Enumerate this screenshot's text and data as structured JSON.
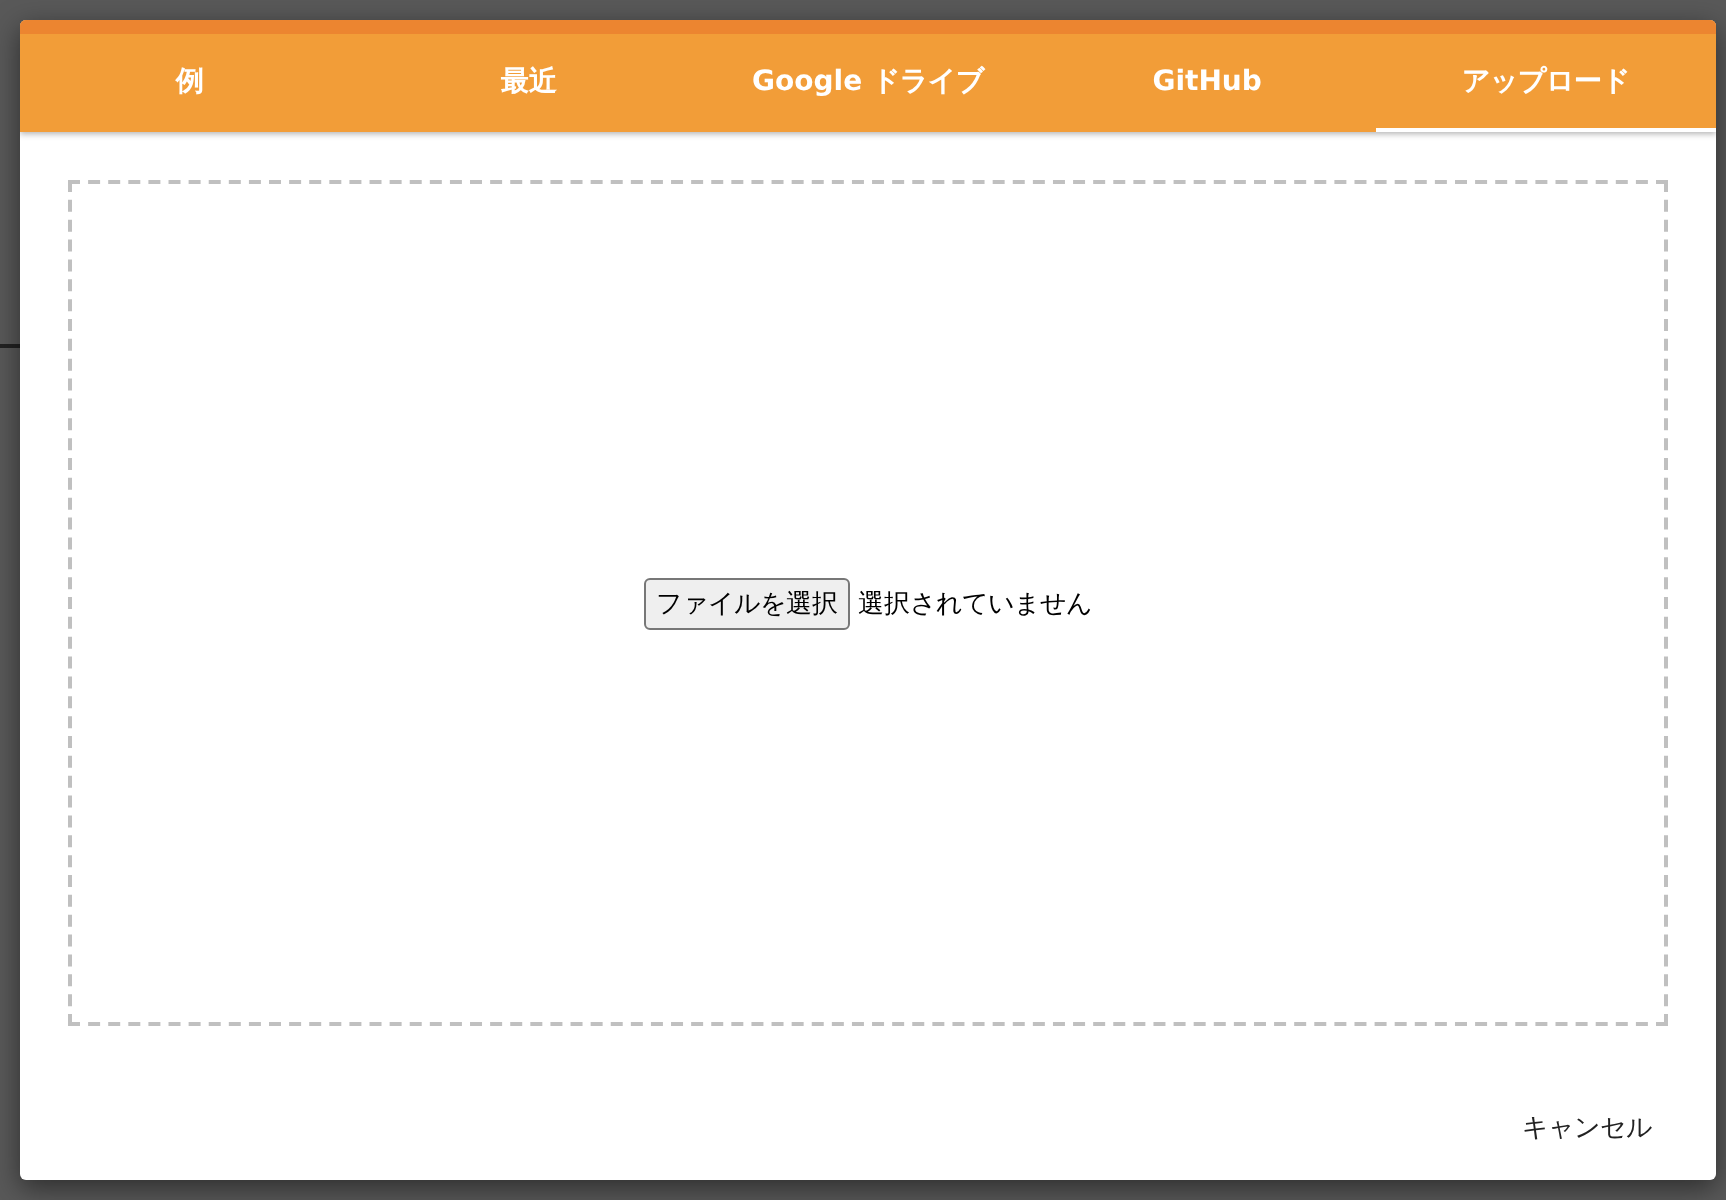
{
  "dialog": {
    "tabs": [
      {
        "label": "例",
        "selected": false
      },
      {
        "label": "最近",
        "selected": false
      },
      {
        "label": "Google ドライブ",
        "selected": false
      },
      {
        "label": "GitHub",
        "selected": false
      },
      {
        "label": "アップロード",
        "selected": true
      }
    ],
    "upload": {
      "button": "ファイルを選択",
      "status": "選択されていません"
    },
    "buttons": [
      "キャンセル"
    ]
  }
}
